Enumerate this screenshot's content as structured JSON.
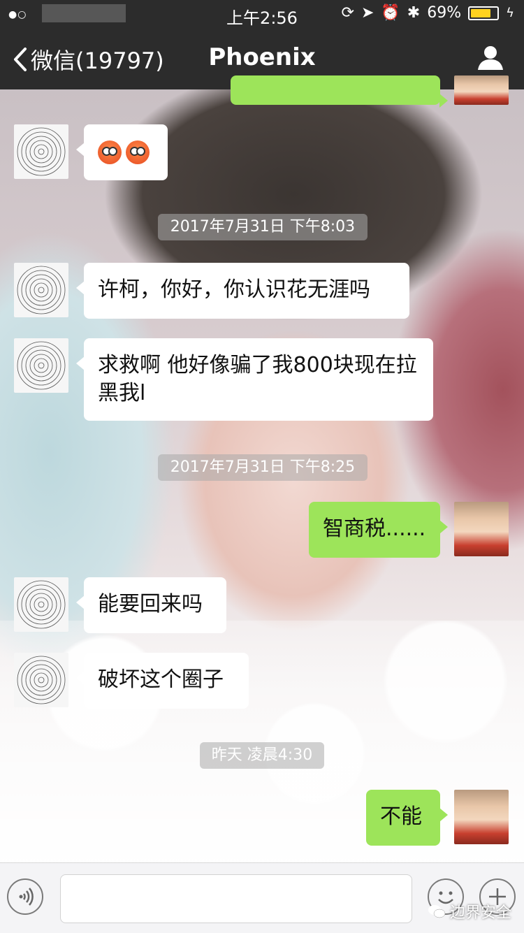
{
  "status_bar": {
    "signal": "●○",
    "time": "上午2:56",
    "battery_percent": "69%",
    "battery_level": 0.69,
    "icons": [
      "rotation-lock-icon",
      "location-icon",
      "alarm-icon",
      "bluetooth-icon",
      "battery-icon",
      "charging-icon"
    ]
  },
  "nav": {
    "back_label": "微信(19797)",
    "title": "Phoenix",
    "icons": [
      "back-chevron-icon",
      "user-profile-icon"
    ]
  },
  "messages": [
    {
      "type": "in",
      "text": "",
      "emoji": [
        "flushed-face-emoji",
        "flushed-face-emoji"
      ]
    },
    {
      "type": "time",
      "text": "2017年7月31日 下午8:03"
    },
    {
      "type": "in",
      "text": "许柯，你好，你认识花无涯吗"
    },
    {
      "type": "in",
      "text": "求救啊 他好像骗了我800块现在拉黑我l"
    },
    {
      "type": "time",
      "text": "2017年7月31日 下午8:25"
    },
    {
      "type": "out",
      "text": "智商税......"
    },
    {
      "type": "in",
      "text": "能要回来吗"
    },
    {
      "type": "in",
      "text": "破坏这个圈子"
    },
    {
      "type": "time",
      "text": "昨天 凌晨4:30"
    },
    {
      "type": "out",
      "text": "不能"
    }
  ],
  "input_bar": {
    "icons": [
      "voice-icon",
      "emoji-icon",
      "plus-icon"
    ]
  },
  "watermark": {
    "text": "边界安全"
  },
  "colors": {
    "bar": "#2c2c2c",
    "out_bubble": "#9de45a",
    "in_bubble": "#ffffff",
    "battery": "#ffd21f"
  }
}
